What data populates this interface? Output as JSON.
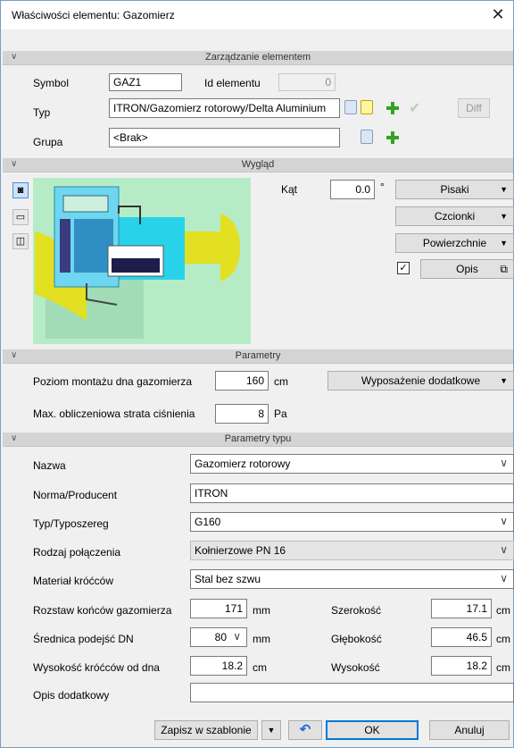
{
  "window": {
    "title": "Właściwości elementu: Gazomierz",
    "close": "✕"
  },
  "sections": {
    "management": "Zarządzanie elementem",
    "appearance": "Wygląd",
    "params": "Parametry",
    "type_params": "Parametry typu"
  },
  "management": {
    "symbol_label": "Symbol",
    "symbol_value": "GAZ1",
    "id_label": "Id elementu",
    "id_value": "0",
    "type_label": "Typ",
    "type_value": "ITRON/Gazomierz rotorowy/Delta Aluminium",
    "diff_label": "Diff",
    "group_label": "Grupa",
    "group_value": "<Brak>"
  },
  "appearance": {
    "angle_label": "Kąt",
    "angle_value": "0.0",
    "angle_unit": "°",
    "pens_label": "Pisaki",
    "fonts_label": "Czcionki",
    "surfaces_label": "Powierzchnie",
    "desc_label": "Opis",
    "desc_checked": true
  },
  "params": {
    "mount_label": "Poziom montażu dna gazomierza",
    "mount_value": "160",
    "mount_unit": "cm",
    "extra_label": "Wyposażenie dodatkowe",
    "loss_label": "Max. obliczeniowa strata ciśnienia",
    "loss_value": "8",
    "loss_unit": "Pa"
  },
  "type_params": {
    "name_label": "Nazwa",
    "name_value": "Gazomierz rotorowy",
    "norm_label": "Norma/Producent",
    "norm_value": "ITRON",
    "series_label": "Typ/Typoszereg",
    "series_value": "G160",
    "conn_label": "Rodzaj połączenia",
    "conn_value": "Kołnierzowe PN 16",
    "mat_label": "Materiał króćców",
    "mat_value": "Stal bez szwu",
    "spacing_label": "Rozstaw końców gazomierza",
    "spacing_value": "171",
    "spacing_unit": "mm",
    "width_label": "Szerokość",
    "width_value": "17.1",
    "width_unit": "cm",
    "dn_label": "Średnica podejść DN",
    "dn_value": "80",
    "dn_unit": "mm",
    "depth_label": "Głębokość",
    "depth_value": "46.5",
    "depth_unit": "cm",
    "stub_label": "Wysokość króćców od dna",
    "stub_value": "18.2",
    "stub_unit": "cm",
    "height_label": "Wysokość",
    "height_value": "18.2",
    "height_unit": "cm",
    "extra_desc_label": "Opis dodatkowy",
    "extra_desc_value": ""
  },
  "footer": {
    "save_template": "Zapisz w szablonie",
    "ok": "OK",
    "cancel": "Anuluj"
  },
  "colors": {
    "accent": "#31a520",
    "preview_bg": "#b5ecc6",
    "selected": "#4a90d9"
  },
  "icons": [
    "close-icon",
    "chevron-down-icon",
    "camera-icon",
    "folder-icon",
    "cube-icon",
    "plus-icon",
    "check-icon",
    "undo-icon",
    "popup-icon"
  ]
}
